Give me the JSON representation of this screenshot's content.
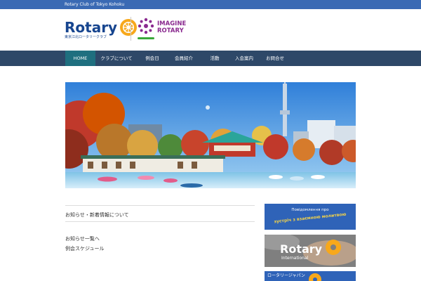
{
  "topbar": {
    "text": "Rotary Club of Tokyo Kohoku"
  },
  "logo": {
    "word": "Rotary",
    "sub": "東京江北ロータリークラブ"
  },
  "imagine": {
    "line1": "IMAGINE",
    "line2": "ROTARY"
  },
  "nav": {
    "items": [
      {
        "label": "HOME",
        "active": true
      },
      {
        "label": "クラブについて",
        "active": false
      },
      {
        "label": "例会日",
        "active": false
      },
      {
        "label": "会員紹介",
        "active": false
      },
      {
        "label": "活動",
        "active": false
      },
      {
        "label": "入会案内",
        "active": false
      },
      {
        "label": "お問合せ",
        "active": false
      }
    ]
  },
  "main": {
    "section_title": "お知らせ・新着情報について",
    "news": [
      "お知らせ一覧へ",
      "例会スケジュール"
    ]
  },
  "sidebar": {
    "banner1": {
      "line1": "Повідомлення про",
      "line2": "зустріч з взаємною молитвою"
    },
    "banner2": {
      "word": "Rotary",
      "sub": "International"
    },
    "banner3": {
      "text": "ロータリージャパン"
    }
  },
  "colors": {
    "topbar": "#3a6ab4",
    "nav": "#2e4868",
    "nav_active": "#1f6f7f",
    "rotary_blue": "#17458f",
    "rotary_gold": "#f7a81b",
    "imagine_purple": "#8a2a8f"
  }
}
